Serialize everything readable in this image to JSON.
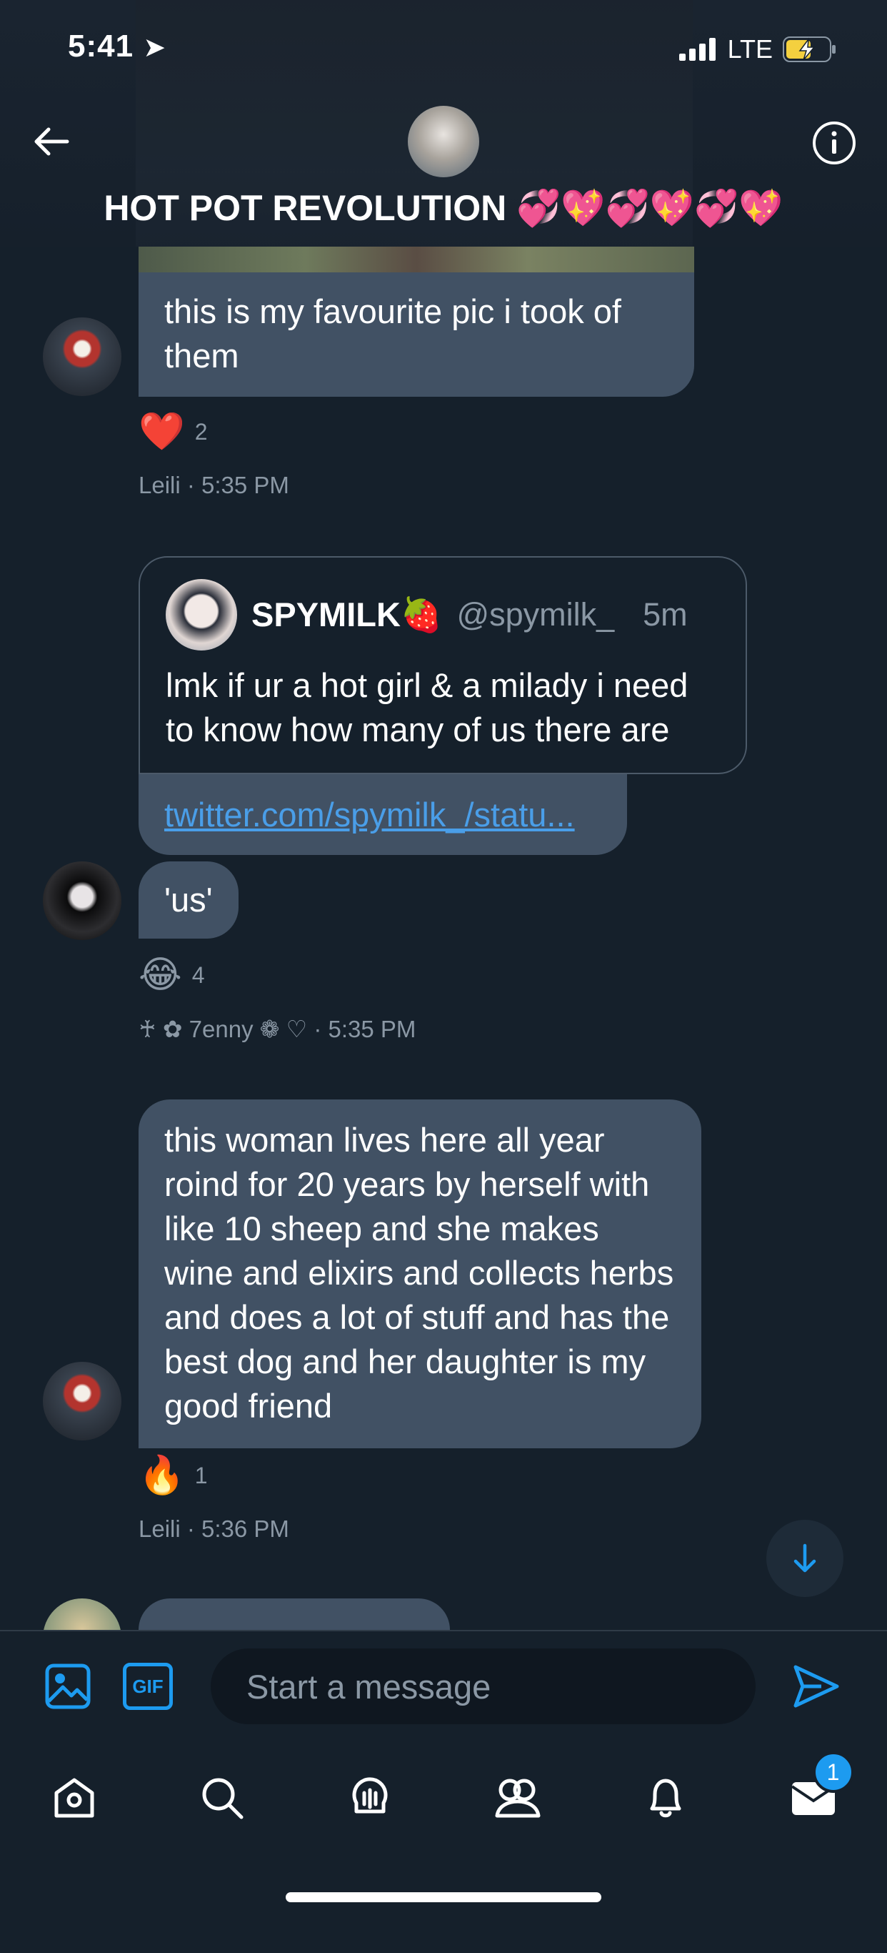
{
  "status_bar": {
    "time": "5:41",
    "network": "LTE"
  },
  "header": {
    "title": "HOT POT REVOLUTION",
    "title_emoji": "💞💖💞💖💞💖"
  },
  "messages": {
    "m1": {
      "text": "this is my favourite pic i took of them",
      "reaction_emoji": "❤️",
      "reaction_count": "2",
      "meta": "Leili · 5:35 PM"
    },
    "quote": {
      "name": "SPYMILK🍓",
      "handle": "@spymilk_",
      "time": "5m",
      "text": "lmk if ur a hot girl & a milady i need to know how many of us there are"
    },
    "link": "twitter.com/spymilk_/statu...",
    "m2": {
      "text": "'us'",
      "reaction_emoji": "😂",
      "reaction_count": "4",
      "meta": "♰ ✿ 7enny ❁ ♡ · 5:35 PM"
    },
    "m3": {
      "text": "this woman lives here all year roind for 20 years by herself with like 10 sheep and she makes wine and elixirs and collects herbs and does a lot of stuff and has the best dog and her daughter is my good friend",
      "reaction_emoji": "🔥",
      "reaction_count": "1",
      "meta": "Leili · 5:36 PM"
    }
  },
  "composer": {
    "placeholder": "Start a message",
    "gif_label": "GIF"
  },
  "nav": {
    "messages_badge": "1"
  },
  "colors": {
    "background": "#15202b",
    "bubble": "#415164",
    "accent": "#1d9bf0",
    "muted": "#8b98a5"
  }
}
